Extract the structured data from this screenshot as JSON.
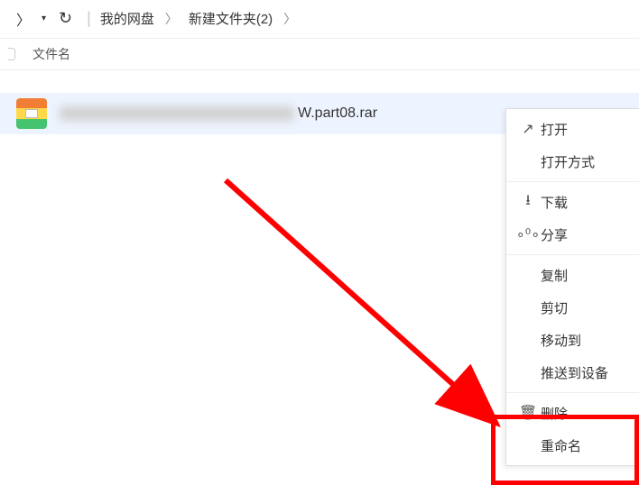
{
  "toolbar": {
    "breadcrumb": {
      "crumb1": "我的网盘",
      "crumb2": "新建文件夹(2)"
    }
  },
  "columns": {
    "name": "文件名"
  },
  "file": {
    "name_visible": "W.part08.rar"
  },
  "menu": {
    "open": "打开",
    "open_with": "打开方式",
    "download": "下载",
    "share": "分享",
    "copy": "复制",
    "cut": "剪切",
    "move_to": "移动到",
    "push_to_device": "推送到设备",
    "delete": "删除",
    "rename": "重命名"
  }
}
